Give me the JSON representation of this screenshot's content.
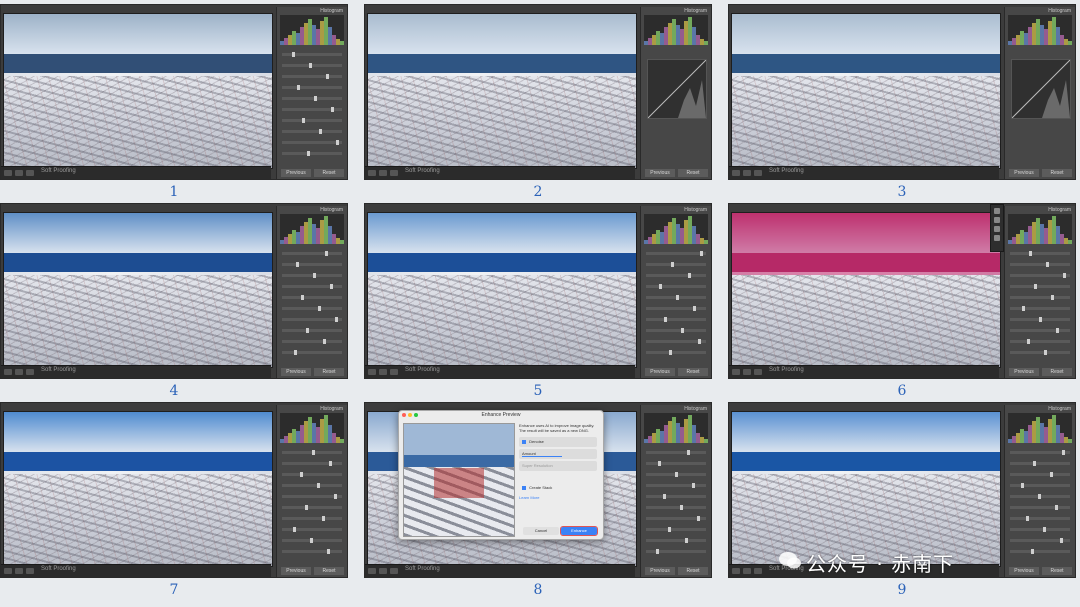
{
  "panels": [
    {
      "number": "1",
      "sky": "#9db2c8",
      "sea": "#314f76",
      "tint": "none"
    },
    {
      "number": "2",
      "sky": "#a9bccf",
      "sea": "#2f5583",
      "tint": "none"
    },
    {
      "number": "3",
      "sky": "#aabdd0",
      "sea": "#2e5684",
      "tint": "none"
    },
    {
      "number": "4",
      "sky": "#5f8fc6",
      "sea": "#1d4d92",
      "tint": "none"
    },
    {
      "number": "5",
      "sky": "#6b9ad0",
      "sea": "#1c4f98",
      "tint": "none"
    },
    {
      "number": "6",
      "sky": "#b03c70",
      "sea": "#a02b60",
      "tint": "magenta"
    },
    {
      "number": "7",
      "sky": "#4f8bd0",
      "sea": "#1c53a3",
      "tint": "none"
    },
    {
      "number": "8",
      "sky": "#8aa9cf",
      "sea": "#2b5a98",
      "tint": "none"
    },
    {
      "number": "9",
      "sky": "#5a91d2",
      "sea": "#1a56a5",
      "tint": "none"
    }
  ],
  "lightroom": {
    "histogram_label": "Histogram",
    "previous_button": "Previous",
    "reset_button": "Reset",
    "soft_proofing": "Soft Proofing"
  },
  "dialog": {
    "title": "Enhance Preview",
    "description": "Enhance uses AI to improve image quality. The result will be saved as a new DNG.",
    "option_denoise": "Denoise",
    "option_amount": "Amount",
    "option_super_resolution": "Super Resolution",
    "option_stack": "Create Stack",
    "learn_more": "Learn More",
    "cancel_button": "Cancel",
    "enhance_button": "Enhance"
  },
  "watermark": {
    "text": "公众号 · 赤南下"
  },
  "colors": {
    "number_blue": "#2b62b8",
    "panel_dark": "#3c3c3c",
    "side_panel": "#474747",
    "enhance_blue": "#3b82f6"
  }
}
